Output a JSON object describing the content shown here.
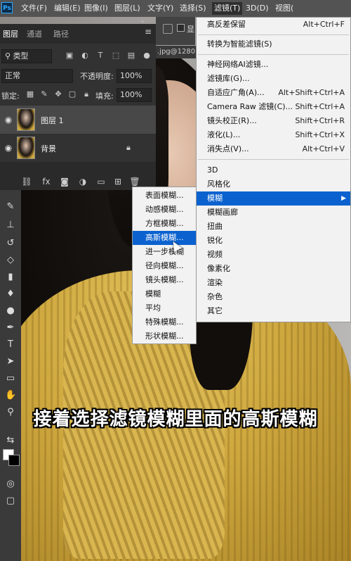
{
  "menubar": {
    "logo": "Ps",
    "items": [
      "文件(F)",
      "编辑(E)",
      "图像(I)",
      "图层(L)",
      "文字(Y)",
      "选择(S)",
      "滤镜(T)",
      "3D(D)",
      "视图("
    ],
    "active_index": 6
  },
  "document_tab": ".jpg@1280",
  "options_bar": {
    "checkbox_label": "显"
  },
  "layers_panel": {
    "tabs": [
      "图层",
      "通道",
      "路径"
    ],
    "collapse_glyph": "«",
    "menu_glyph": "≡",
    "filter_kind": "类型",
    "blend_mode": "正常",
    "opacity_label": "不透明度:",
    "opacity_value": "100%",
    "lock_label": "锁定:",
    "fill_label": "填充:",
    "fill_value": "100%",
    "layers": [
      {
        "name": "图层 1",
        "selected": true
      },
      {
        "name": "背景",
        "locked": true
      }
    ]
  },
  "filter_menu": {
    "items": [
      {
        "label": "高反差保留",
        "shortcut": "Alt+Ctrl+F"
      },
      {
        "label": "转换为智能滤镜(S)",
        "shortcut": ""
      },
      {
        "label": "神经网络AI滤镜...",
        "shortcut": ""
      },
      {
        "label": "滤镜库(G)...",
        "shortcut": ""
      },
      {
        "label": "自适应广角(A)...",
        "shortcut": "Alt+Shift+Ctrl+A"
      },
      {
        "label": "Camera Raw 滤镜(C)...",
        "shortcut": "Shift+Ctrl+A"
      },
      {
        "label": "镜头校正(R)...",
        "shortcut": "Shift+Ctrl+R"
      },
      {
        "label": "液化(L)...",
        "shortcut": "Shift+Ctrl+X"
      },
      {
        "label": "消失点(V)...",
        "shortcut": "Alt+Ctrl+V"
      },
      {
        "label": "3D",
        "shortcut": ""
      },
      {
        "label": "风格化",
        "shortcut": ""
      },
      {
        "label": "模糊",
        "shortcut": "",
        "highlighted": true
      },
      {
        "label": "模糊画廊",
        "shortcut": ""
      },
      {
        "label": "扭曲",
        "shortcut": ""
      },
      {
        "label": "锐化",
        "shortcut": ""
      },
      {
        "label": "视频",
        "shortcut": ""
      },
      {
        "label": "像素化",
        "shortcut": ""
      },
      {
        "label": "渲染",
        "shortcut": ""
      },
      {
        "label": "杂色",
        "shortcut": ""
      },
      {
        "label": "其它",
        "shortcut": ""
      }
    ]
  },
  "blur_submenu": {
    "items": [
      "表面模糊...",
      "动感模糊...",
      "方框模糊...",
      "高斯模糊...",
      "进一步模糊",
      "径向模糊...",
      "镜头模糊...",
      "模糊",
      "平均",
      "特殊模糊...",
      "形状模糊..."
    ],
    "highlighted_index": 3
  },
  "caption": "接着选择滤镜模糊里面的高斯模糊",
  "colors": {
    "menu_highlight": "#0b62cf",
    "menubar": "#535353",
    "panel": "#323232"
  }
}
